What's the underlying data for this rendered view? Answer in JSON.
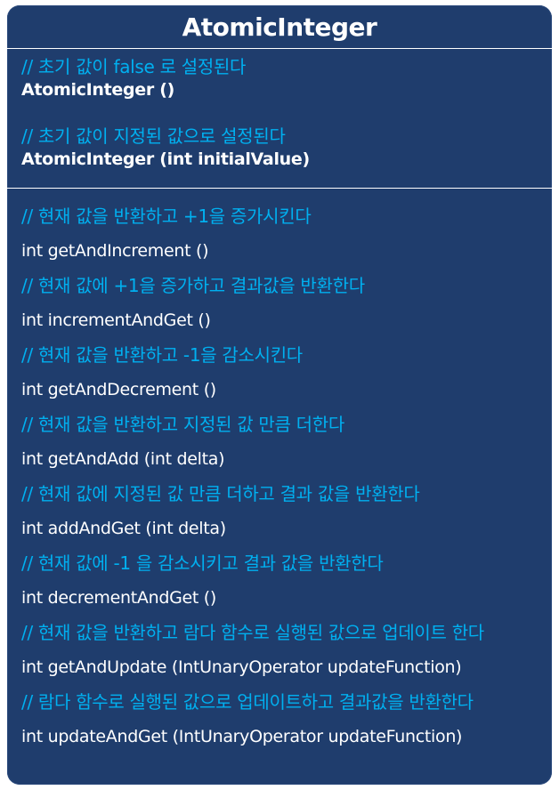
{
  "class_name": "AtomicInteger",
  "constructors": [
    {
      "comment": "// 초기 값이 false 로 설정된다",
      "signature": "AtomicInteger ()"
    },
    {
      "comment": "// 초기 값이 지정된 값으로 설정된다",
      "signature": "AtomicInteger (int initialValue)"
    }
  ],
  "methods": [
    {
      "comment": "// 현재 값을 반환하고 +1을 증가시킨다",
      "signature": "int getAndIncrement ()"
    },
    {
      "comment": "// 현재 값에 +1을 증가하고 결과값을 반환한다",
      "signature": "int incrementAndGet ()"
    },
    {
      "comment": "// 현재 값을 반환하고 -1을 감소시킨다",
      "signature": "int getAndDecrement ()"
    },
    {
      "comment": "// 현재 값을 반환하고 지정된 값 만큼 더한다",
      "signature": "int getAndAdd (int delta)"
    },
    {
      "comment": "// 현재 값에 지정된 값 만큼 더하고 결과 값을 반환한다",
      "signature": "int addAndGet (int delta)"
    },
    {
      "comment": "// 현재 값에 -1 을 감소시키고 결과 값을 반환한다",
      "signature": "int decrementAndGet ()"
    },
    {
      "comment": "// 현재 값을 반환하고 람다 함수로 실행된 값으로 업데이트 한다",
      "signature": "int getAndUpdate (IntUnaryOperator updateFunction)"
    },
    {
      "comment": "// 람다 함수로 실행된 값으로 업데이트하고 결과값을 반환한다",
      "signature": "int updateAndGet (IntUnaryOperator updateFunction)"
    }
  ],
  "colors": {
    "background": "#1f3d6d",
    "comment": "#00b0f0",
    "text": "#ffffff"
  }
}
